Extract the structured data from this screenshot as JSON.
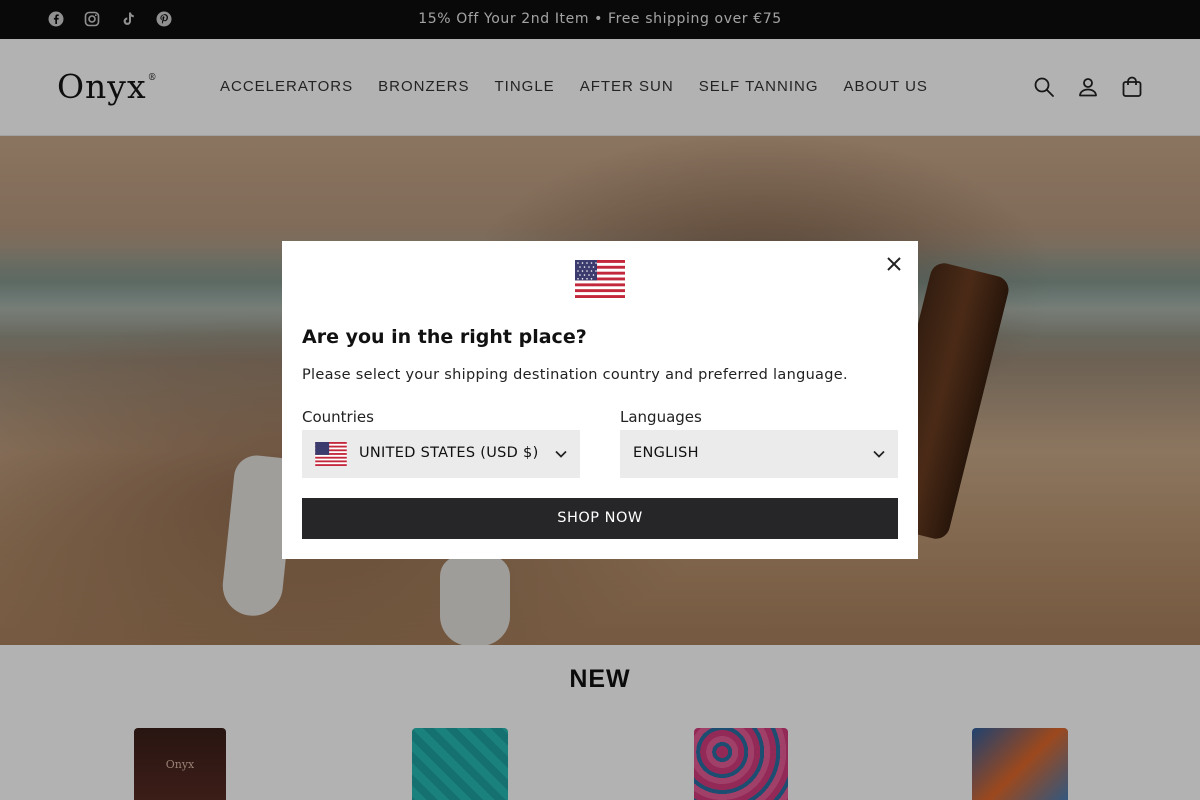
{
  "announcement": {
    "text": "15% Off Your 2nd Item • Free shipping over €75",
    "social_icons": [
      "facebook-icon",
      "instagram-icon",
      "tiktok-icon",
      "pinterest-icon"
    ]
  },
  "header": {
    "logo": "Onyx",
    "logo_mark": "®",
    "nav": [
      "ACCELERATORS",
      "BRONZERS",
      "TINGLE",
      "AFTER SUN",
      "SELF TANNING",
      "ABOUT US"
    ],
    "icons": [
      "search-icon",
      "account-icon",
      "cart-icon"
    ]
  },
  "hero": {
    "image": "beach-model-with-tanning-lotion"
  },
  "new_section": {
    "title": "NEW",
    "products": [
      {
        "label": "Onyx",
        "color": "#4a261f"
      },
      {
        "label": "",
        "color": "#22aaa6"
      },
      {
        "label": "",
        "color": "#d23b7d"
      },
      {
        "label": "",
        "color": "#2f5fa0"
      }
    ]
  },
  "modal": {
    "flag": "us-flag",
    "title": "Are you in the right place?",
    "subtitle": "Please select your shipping destination country and preferred language.",
    "countries_label": "Countries",
    "country_value": "UNITED STATES (USD $)",
    "languages_label": "Languages",
    "language_value": "ENGLISH",
    "button": "SHOP NOW"
  },
  "colors": {
    "announcement_bg": "#0d0d0d",
    "button_bg": "#262628",
    "select_bg": "#ebebeb",
    "overlay": "rgba(0,0,0,0.3)"
  }
}
